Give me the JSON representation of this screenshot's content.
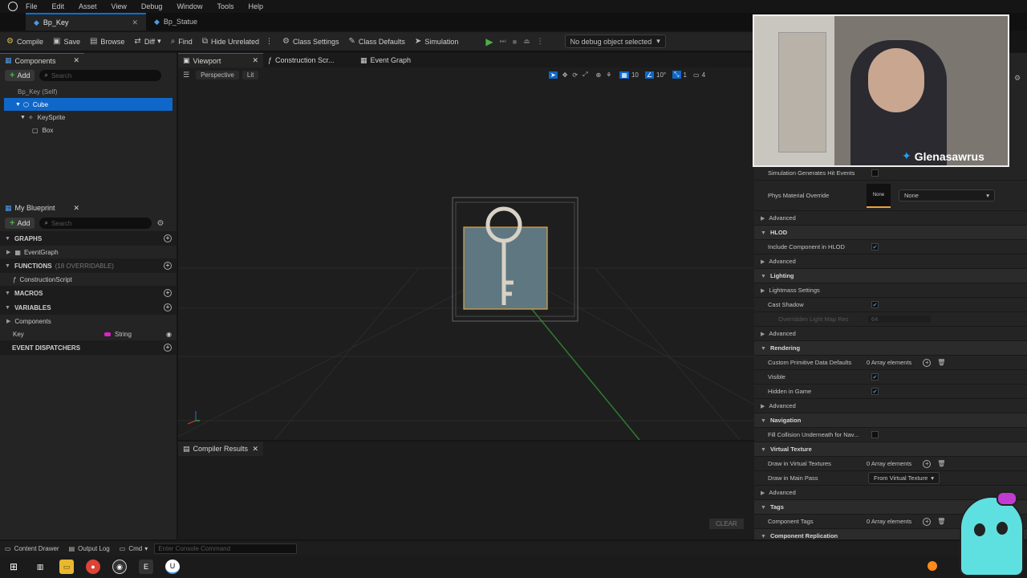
{
  "menu": [
    "File",
    "Edit",
    "Asset",
    "View",
    "Debug",
    "Window",
    "Tools",
    "Help"
  ],
  "doc_tabs": {
    "active": "Bp_Key",
    "other": "Bp_Statue"
  },
  "toolbar": {
    "compile": "Compile",
    "save": "Save",
    "browse": "Browse",
    "diff": "Diff",
    "find": "Find",
    "hide_unrelated": "Hide Unrelated",
    "class_settings": "Class Settings",
    "class_defaults": "Class Defaults",
    "simulation": "Simulation",
    "debug_object": "No debug object selected"
  },
  "components_panel": {
    "title": "Components",
    "add": "Add",
    "search_placeholder": "Search",
    "items": [
      "Bp_Key (Self)",
      "Cube",
      "KeySprite",
      "Box"
    ]
  },
  "my_blueprint": {
    "title": "My Blueprint",
    "add": "Add",
    "search_placeholder": "Search",
    "graphs": "GRAPHS",
    "event_graph": "EventGraph",
    "functions": "FUNCTIONS",
    "functions_count": "(18 OVERRIDABLE)",
    "construction_script": "ConstructionScript",
    "macros": "MACROS",
    "variables": "VARIABLES",
    "components_cat": "Components",
    "var_name": "Key",
    "var_type": "String",
    "event_dispatchers": "EVENT DISPATCHERS"
  },
  "editor_tabs": [
    "Viewport",
    "Construction Scr...",
    "Event Graph"
  ],
  "viewport": {
    "perspective": "Perspective",
    "lit": "Lit",
    "grid_value": "10",
    "angle_value": "10°",
    "scale_value": "1",
    "camera_value": "4"
  },
  "compiler": {
    "title": "Compiler Results",
    "clear": "CLEAR"
  },
  "details": {
    "rows": [
      {
        "type": "prop",
        "label": "Simulation Generates Hit Events",
        "check": false
      },
      {
        "type": "material",
        "label": "Phys Material Override",
        "thumb": "None",
        "value": "None"
      },
      {
        "type": "adv",
        "label": "Advanced"
      },
      {
        "type": "cat",
        "label": "HLOD"
      },
      {
        "type": "prop",
        "label": "Include Component in HLOD",
        "check": true
      },
      {
        "type": "adv",
        "label": "Advanced"
      },
      {
        "type": "cat",
        "label": "Lighting"
      },
      {
        "type": "adv",
        "label": "Lightmass Settings"
      },
      {
        "type": "prop",
        "label": "Cast Shadow",
        "check": true
      },
      {
        "type": "disabled",
        "label": "Overridden Light Map Res",
        "value": "64"
      },
      {
        "type": "adv",
        "label": "Advanced"
      },
      {
        "type": "cat",
        "label": "Rendering"
      },
      {
        "type": "array",
        "label": "Custom Primitive Data Defaults",
        "value": "0 Array elements"
      },
      {
        "type": "prop",
        "label": "Visible",
        "check": true
      },
      {
        "type": "prop",
        "label": "Hidden in Game",
        "check": true
      },
      {
        "type": "adv",
        "label": "Advanced"
      },
      {
        "type": "cat",
        "label": "Navigation"
      },
      {
        "type": "prop",
        "label": "Fill Collision Underneath for Nav...",
        "check": false
      },
      {
        "type": "cat",
        "label": "Virtual Texture"
      },
      {
        "type": "array",
        "label": "Draw in Virtual Textures",
        "value": "0 Array elements"
      },
      {
        "type": "select",
        "label": "Draw in Main Pass",
        "value": "From Virtual Texture"
      },
      {
        "type": "adv",
        "label": "Advanced"
      },
      {
        "type": "cat",
        "label": "Tags"
      },
      {
        "type": "array",
        "label": "Component Tags",
        "value": "0 Array elements"
      },
      {
        "type": "cat",
        "label": "Component Replication"
      }
    ]
  },
  "webcam": {
    "name": "Glenasawrus"
  },
  "bottom": {
    "content_drawer": "Content Drawer",
    "output_log": "Output Log",
    "cmd": "Cmd",
    "console_placeholder": "Enter Console Command"
  },
  "colors": {
    "accent": "#0f67c9",
    "play_green": "#4cb14c",
    "selection_orange": "#e8a53a"
  }
}
